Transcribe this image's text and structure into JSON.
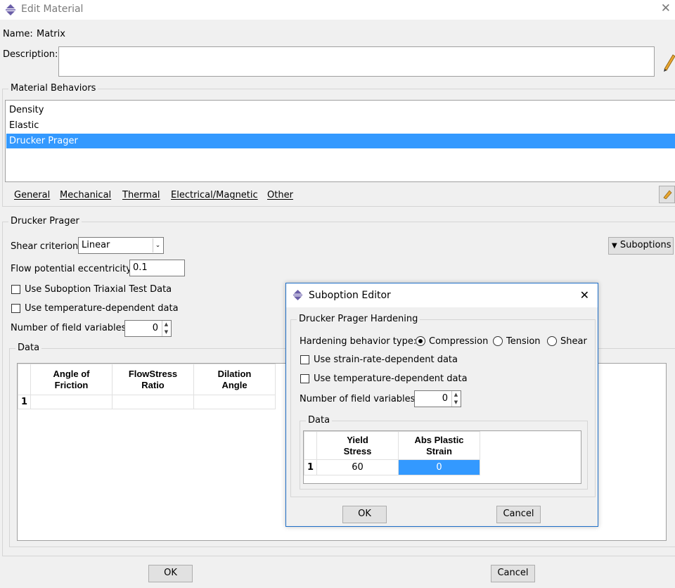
{
  "window": {
    "title": "Edit Material",
    "close_icon": "close-icon"
  },
  "name_label": "Name:",
  "name_value": "Matrix",
  "description_label": "Description:",
  "description_value": "",
  "material_behaviors": {
    "label": "Material Behaviors",
    "items": [
      "Density",
      "Elastic",
      "Drucker Prager"
    ],
    "selected": "Drucker Prager"
  },
  "menu": [
    "General",
    "Mechanical",
    "Thermal",
    "Electrical/Magnetic",
    "Other"
  ],
  "section": {
    "title": "Drucker Prager",
    "shear_criterion_label": "Shear criterion:",
    "shear_criterion_value": "Linear",
    "flow_potential_label": "Flow potential eccentricity:",
    "flow_potential_value": "0.1",
    "use_triaxial_label": "Use Suboption Triaxial Test Data",
    "use_temp_label": "Use temperature-dependent data",
    "num_field_vars_label": "Number of field variables:",
    "num_field_vars_value": "0",
    "suboptions_label": "Suboptions",
    "data_label": "Data",
    "table": {
      "headers": [
        "Angle of\nFriction",
        "FlowStress\nRatio",
        "Dilation\nAngle"
      ],
      "rows": [
        {
          "num": "1",
          "cells": [
            "",
            "",
            ""
          ]
        }
      ]
    }
  },
  "footer": {
    "ok": "OK",
    "cancel": "Cancel"
  },
  "suboption_editor": {
    "title": "Suboption Editor",
    "group_title": "Drucker Prager Hardening",
    "hardening_label": "Hardening behavior type:",
    "hardening_options": [
      "Compression",
      "Tension",
      "Shear"
    ],
    "hardening_selected": "Compression",
    "use_strain_rate_label": "Use strain-rate-dependent data",
    "use_temp_label": "Use temperature-dependent data",
    "num_field_vars_label": "Number of field variables:",
    "num_field_vars_value": "0",
    "data_label": "Data",
    "table": {
      "headers": [
        "Yield\nStress",
        "Abs Plastic\nStrain"
      ],
      "rows": [
        {
          "num": "1",
          "cells": [
            "60",
            "0"
          ]
        }
      ]
    },
    "ok": "OK",
    "cancel": "Cancel"
  },
  "colors": {
    "selection": "#3399ff",
    "dialog_border": "#1e6fc8"
  }
}
